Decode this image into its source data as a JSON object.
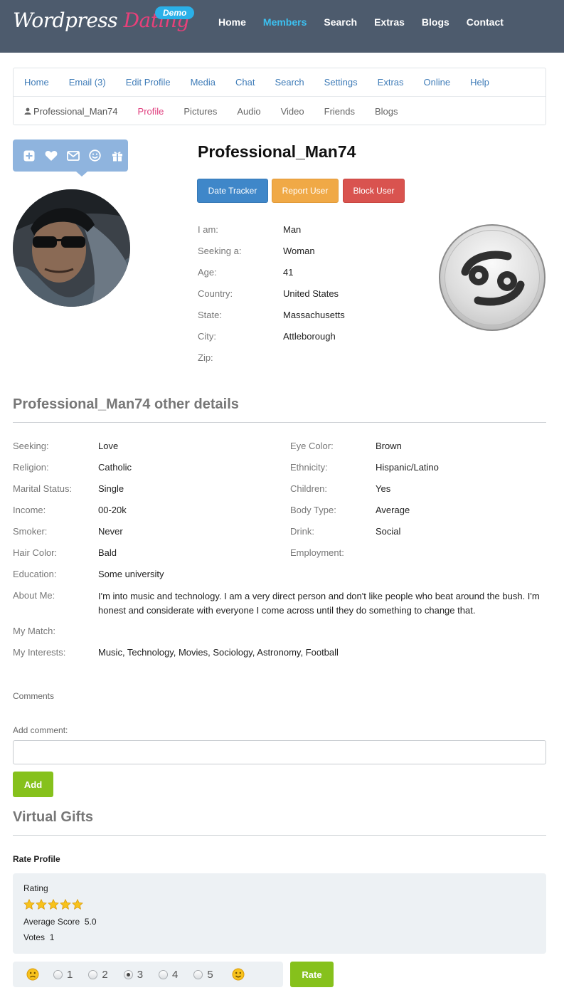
{
  "header": {
    "logo_part1": "Wordpress",
    "logo_part2": "Dating",
    "badge": "Demo",
    "nav": [
      "Home",
      "Members",
      "Search",
      "Extras",
      "Blogs",
      "Contact"
    ],
    "active_nav": "Members"
  },
  "subnav": {
    "row1": [
      "Home",
      "Email (3)",
      "Edit Profile",
      "Media",
      "Chat",
      "Search",
      "Settings",
      "Extras",
      "Online",
      "Help"
    ],
    "user": "Professional_Man74",
    "row2": [
      "Profile",
      "Pictures",
      "Audio",
      "Video",
      "Friends",
      "Blogs"
    ],
    "active": "Profile"
  },
  "actions": [
    "plus-square-icon",
    "heart-icon",
    "envelope-icon",
    "smile-icon",
    "gift-icon"
  ],
  "profile": {
    "username": "Professional_Man74",
    "buttons": {
      "date_tracker": "Date Tracker",
      "report": "Report User",
      "block": "Block User"
    },
    "basic": [
      {
        "label": "I am:",
        "value": "Man"
      },
      {
        "label": "Seeking a:",
        "value": "Woman"
      },
      {
        "label": "Age:",
        "value": "41"
      },
      {
        "label": "Country:",
        "value": "United States"
      },
      {
        "label": "State:",
        "value": "Massachusetts"
      },
      {
        "label": "City:",
        "value": "Attleborough"
      },
      {
        "label": "Zip:",
        "value": ""
      }
    ],
    "zodiac_icon": "cancer-zodiac-icon"
  },
  "details": {
    "title": "Professional_Man74 other details",
    "pairs": [
      {
        "k1": "Seeking:",
        "v1": "Love",
        "k2": "Eye Color:",
        "v2": "Brown"
      },
      {
        "k1": "Religion:",
        "v1": "Catholic",
        "k2": "Ethnicity:",
        "v2": "Hispanic/Latino"
      },
      {
        "k1": "Marital Status:",
        "v1": "Single",
        "k2": "Children:",
        "v2": "Yes"
      },
      {
        "k1": "Income:",
        "v1": "00-20k",
        "k2": "Body Type:",
        "v2": "Average"
      },
      {
        "k1": "Smoker:",
        "v1": "Never",
        "k2": "Drink:",
        "v2": "Social"
      },
      {
        "k1": "Hair Color:",
        "v1": "Bald",
        "k2": "Employment:",
        "v2": ""
      }
    ],
    "education_label": "Education:",
    "education": "Some university",
    "about_label": "About Me:",
    "about": "I'm into music and technology. I am a very direct person and don't like people who beat around the bush. I'm honest and considerate with everyone I come across until they do something to change that.",
    "match_label": "My Match:",
    "match": "",
    "interests_label": "My Interests:",
    "interests": "Music, Technology, Movies, Sociology, Astronomy, Football"
  },
  "comments": {
    "title": "Comments",
    "add_label": "Add comment:",
    "input_value": "",
    "add_button": "Add"
  },
  "gifts": {
    "title": "Virtual Gifts"
  },
  "rating": {
    "section_title": "Rate Profile",
    "box_title": "Rating",
    "stars_filled": 5,
    "avg_label": "Average Score",
    "avg_value": "5.0",
    "votes_label": "Votes",
    "votes_value": "1",
    "options": [
      "1",
      "2",
      "3",
      "4",
      "5"
    ],
    "selected": "3",
    "rate_button": "Rate"
  },
  "colors": {
    "header_bg": "#4d5b6d",
    "active_nav": "#3cc0f0",
    "accent_pink": "#e0407f",
    "btn_blue": "#3f87c9",
    "btn_orange": "#f0a946",
    "btn_red": "#d9534f",
    "btn_green": "#86c11c"
  }
}
